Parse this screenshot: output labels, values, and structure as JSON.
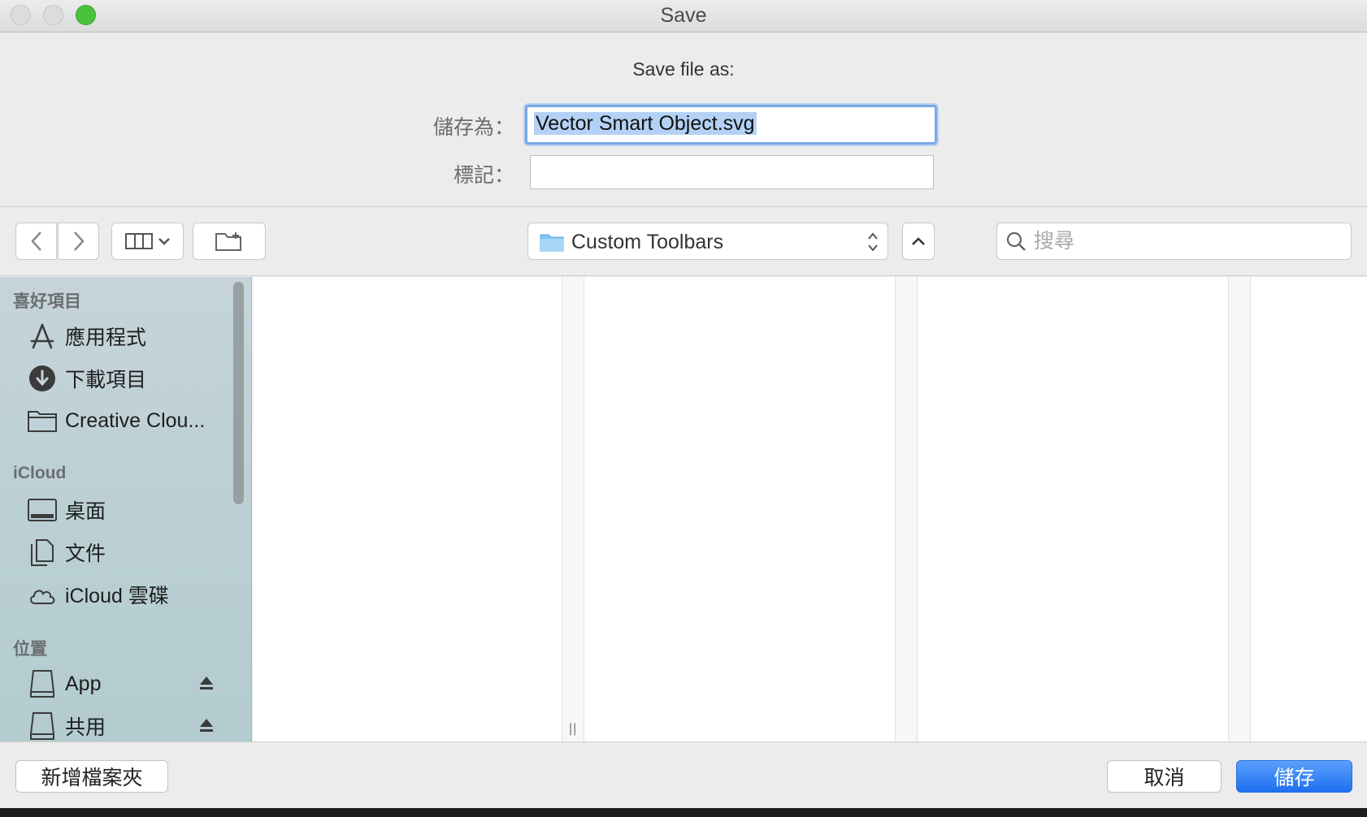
{
  "window": {
    "title": "Save"
  },
  "form": {
    "heading": "Save file as:",
    "name_label": "儲存為：",
    "name_value": "Vector Smart Object.svg",
    "tags_label": "標記：",
    "tags_value": ""
  },
  "toolbar": {
    "location": "Custom Toolbars",
    "search_placeholder": "搜尋"
  },
  "sidebar": {
    "sections": [
      {
        "heading": "喜好項目",
        "items": [
          {
            "label": "應用程式",
            "icon": "applications-icon"
          },
          {
            "label": "下載項目",
            "icon": "downloads-icon"
          },
          {
            "label": "Creative Clou...",
            "icon": "folder-icon"
          }
        ]
      },
      {
        "heading": "iCloud",
        "items": [
          {
            "label": "桌面",
            "icon": "desktop-icon"
          },
          {
            "label": "文件",
            "icon": "documents-icon"
          },
          {
            "label": "iCloud 雲碟",
            "icon": "cloud-icon"
          }
        ]
      },
      {
        "heading": "位置",
        "items": [
          {
            "label": "App",
            "icon": "drive-icon",
            "ejectable": true
          },
          {
            "label": "共用",
            "icon": "drive-icon",
            "ejectable": true
          }
        ]
      }
    ]
  },
  "buttons": {
    "new_folder": "新增檔案夾",
    "cancel": "取消",
    "save": "儲存"
  },
  "colors": {
    "accent": "#1e6ff0",
    "selection": "#b3d1f5",
    "sidebar": "#bdd0d5"
  }
}
